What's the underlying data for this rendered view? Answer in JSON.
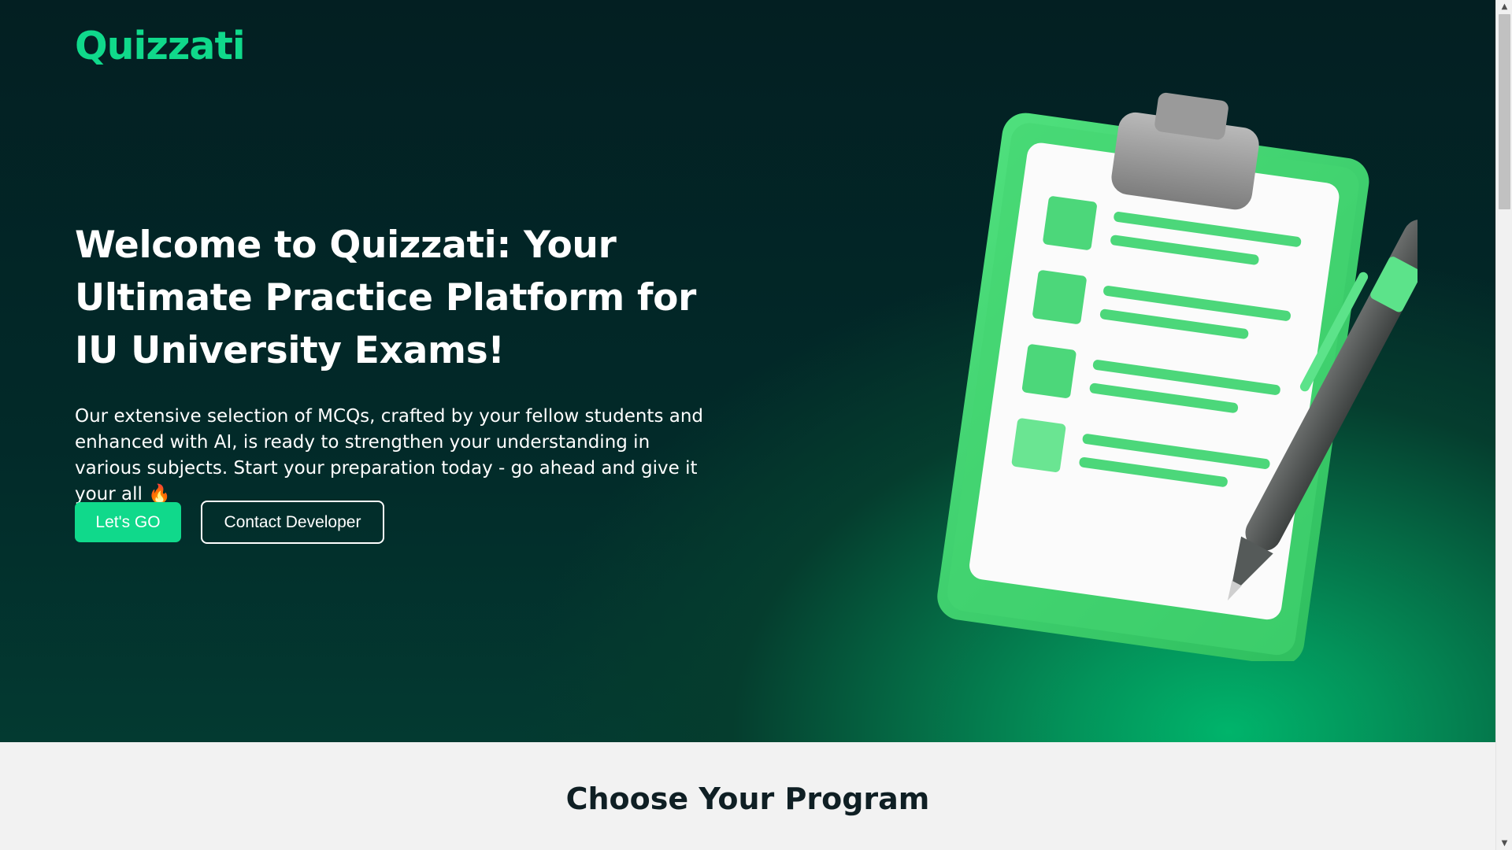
{
  "brand": {
    "name": "Quizzati",
    "color": "#10d98b"
  },
  "hero": {
    "headline": "Welcome to Quizzati: Your Ultimate Practice Platform for IU University Exams!",
    "description": "Our extensive selection of MCQs, crafted by your fellow students and enhanced with AI, is ready to strengthen your understanding in various subjects. Start your preparation today - go ahead and give it your all 🔥",
    "primary_button": "Let's GO",
    "secondary_button": "Contact Developer",
    "illustration_icon": "clipboard-checklist-pen-icon"
  },
  "programs": {
    "title": "Choose Your Program"
  },
  "scrollbar": {
    "up_icon": "▲",
    "down_icon": "▼"
  },
  "colors": {
    "hero_background": "#031f22",
    "accent_green": "#10d98b",
    "section_background": "#f2f2f2",
    "heading_dark": "#0f1f24"
  }
}
